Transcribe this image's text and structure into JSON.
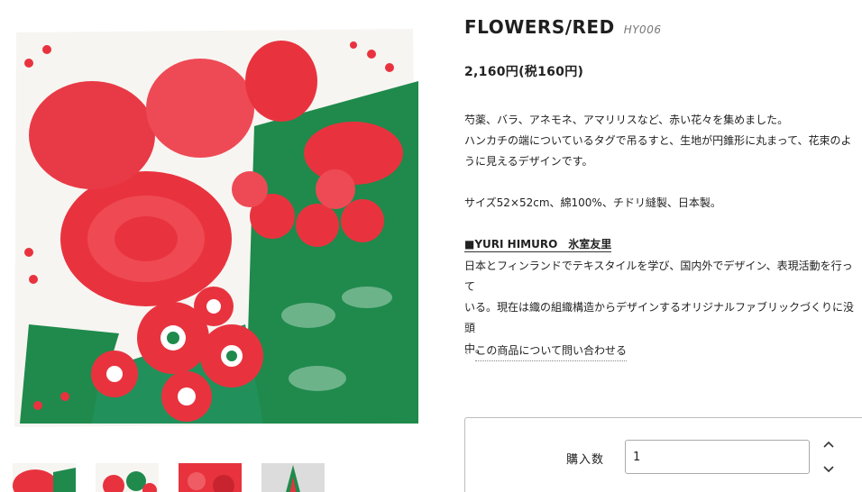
{
  "product": {
    "title": "FLOWERS/RED",
    "sku": "HY006",
    "price": "2,160円(税160円)",
    "description": [
      "芍薬、バラ、アネモネ、アマリリスなど、赤い花々を集めました。",
      "ハンカチの端についているタグで吊るすと、生地が円錐形に丸まって、花束のよ",
      "うに見えるデザインです。"
    ],
    "spec": "サイズ52×52cm、綿100%、チドリ縫製、日本製。",
    "designer_heading": "■YURI HIMURO　氷室友里",
    "designer_bio": [
      "日本とフィンランドでテキスタイルを学び、国内外でデザイン、表現活動を行って",
      "いる。現在は織の組織構造からデザインするオリジナルファブリックづくりに没頭",
      "中。"
    ]
  },
  "inquiry_link": "この商品について問い合わせる",
  "cart": {
    "qty_label": "購入数",
    "qty_value": "1"
  },
  "icons": {
    "inquiry_chevron": "chevron-left-icon",
    "qty_up": "chevron-up-icon",
    "qty_down": "chevron-down-icon"
  },
  "colors": {
    "flower_red": "#e8333f",
    "leaf_green": "#1f8a4c",
    "fabric": "#f7f4f0"
  }
}
